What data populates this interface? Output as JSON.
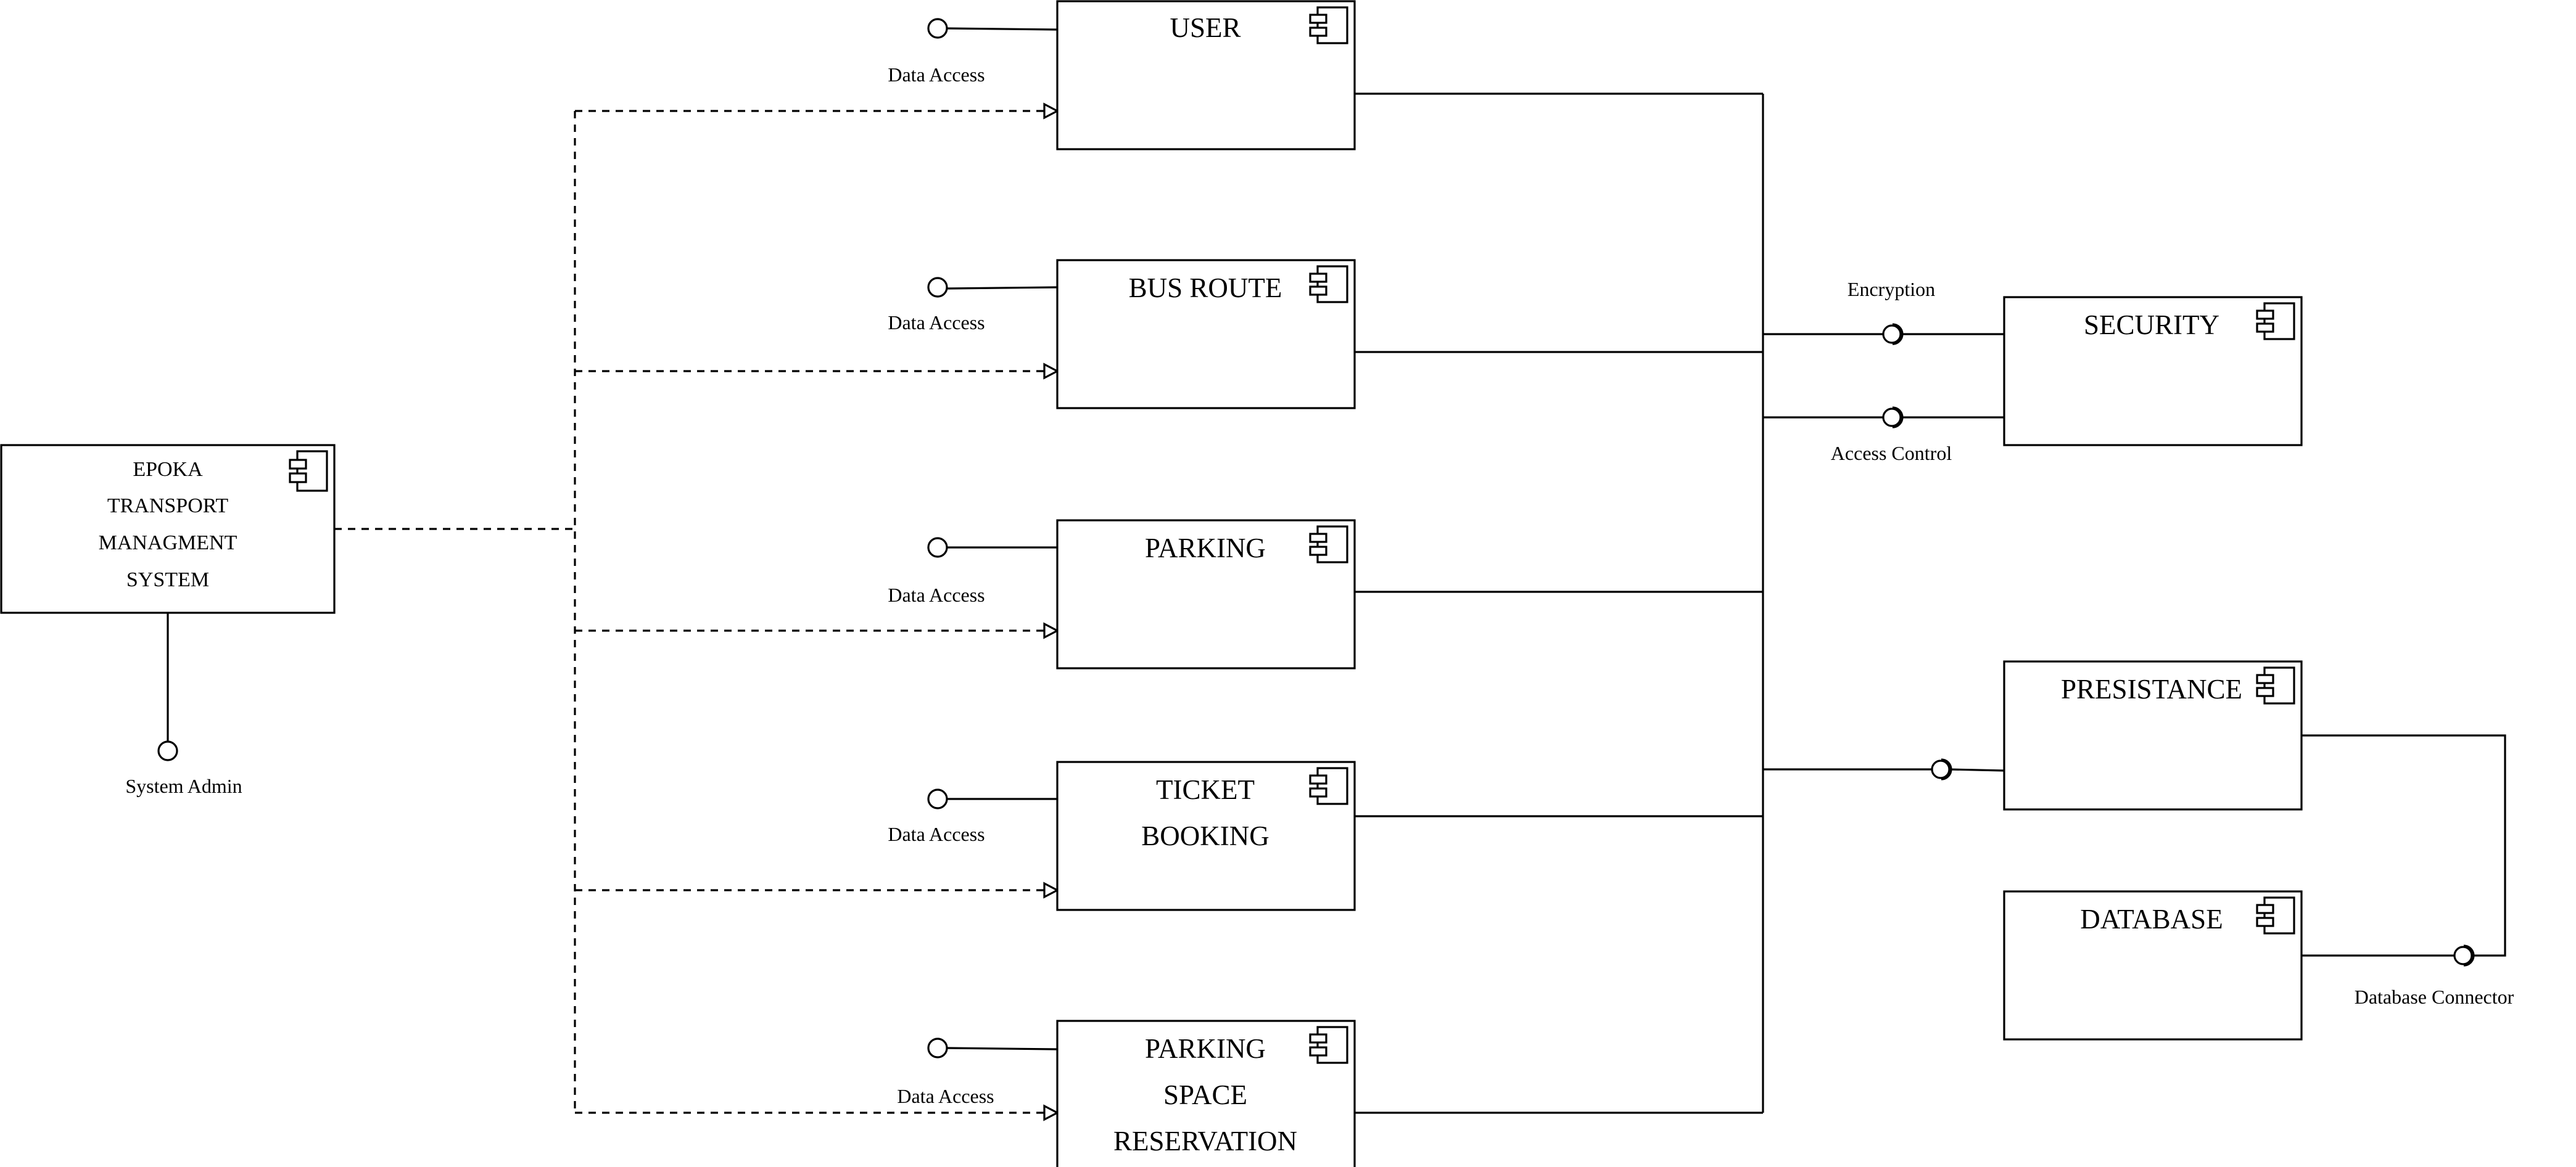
{
  "diagram": {
    "main_component": {
      "title_lines": [
        "EPOKA",
        "TRANSPORT",
        "MANAGMENT",
        "SYSTEM"
      ],
      "interface_label": "System Admin"
    },
    "modules": [
      {
        "id": "user",
        "title_lines": [
          "USER"
        ],
        "port_label": "Data Access"
      },
      {
        "id": "bus-route",
        "title_lines": [
          "BUS ROUTE"
        ],
        "port_label": "Data Access"
      },
      {
        "id": "parking",
        "title_lines": [
          "PARKING"
        ],
        "port_label": "Data Access"
      },
      {
        "id": "ticket-booking",
        "title_lines": [
          "TICKET",
          "BOOKING"
        ],
        "port_label": "Data Access"
      },
      {
        "id": "parking-space-reservation",
        "title_lines": [
          "PARKING",
          "SPACE",
          "RESERVATION"
        ],
        "port_label": "Data Access"
      }
    ],
    "security": {
      "title": "SECURITY",
      "interfaces": [
        "Encryption",
        "Access Control"
      ]
    },
    "persistence": {
      "title": "PRESISTANCE"
    },
    "database": {
      "title": "DATABASE",
      "connector_label": "Database Connector"
    }
  }
}
